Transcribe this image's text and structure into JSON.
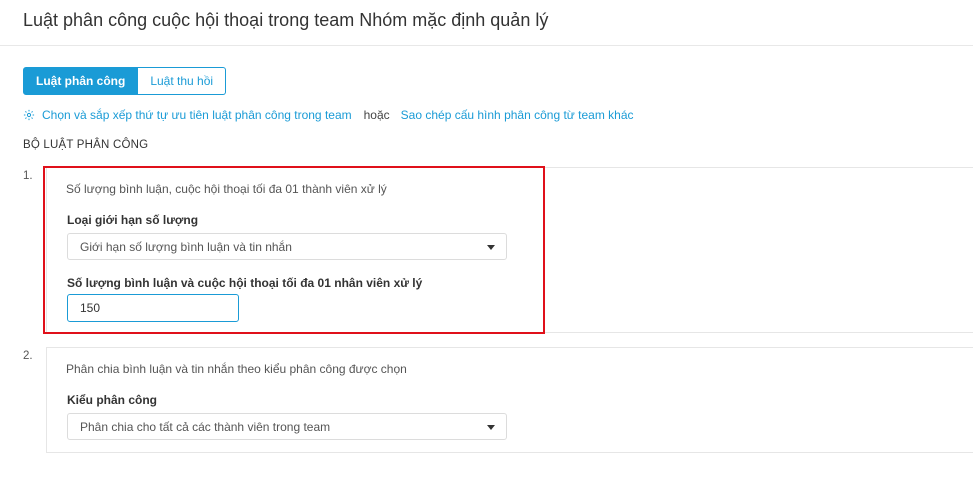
{
  "header": {
    "title": "Luật phân công cuộc hội thoại trong team Nhóm mặc định quản lý"
  },
  "tabs": [
    {
      "label": "Luật phân công",
      "active": true
    },
    {
      "label": "Luật thu hồi",
      "active": false
    }
  ],
  "links": {
    "priority_link": "Chọn và sắp xếp thứ tự ưu tiên luật phân công trong team",
    "or_text": "hoặc",
    "copy_link": "Sao chép cấu hình phân công từ team khác"
  },
  "section_title": "BỘ LUẬT PHÂN CÔNG",
  "rules": [
    {
      "number": "1.",
      "description": "Số lượng bình luận, cuộc hội thoại tối đa 01 thành viên xử lý",
      "limit_type_label": "Loại giới hạn số lượng",
      "limit_type_value": "Giới hạn số lượng bình luận và tin nhắn",
      "max_label": "Số lượng bình luận và cuộc hội thoại tối đa 01 nhân viên xử lý",
      "max_value": "150"
    },
    {
      "number": "2.",
      "description": "Phân chia bình luận và tin nhắn theo kiểu phân công được chọn",
      "assign_type_label": "Kiểu phân công",
      "assign_type_value": "Phân chia cho tất cả các thành viên trong team"
    }
  ],
  "colors": {
    "accent": "#1a9bd6",
    "highlight": "#e0101a"
  },
  "icons": {
    "priority_link_icon": "gear-icon",
    "select_caret": "caret-down-icon"
  }
}
